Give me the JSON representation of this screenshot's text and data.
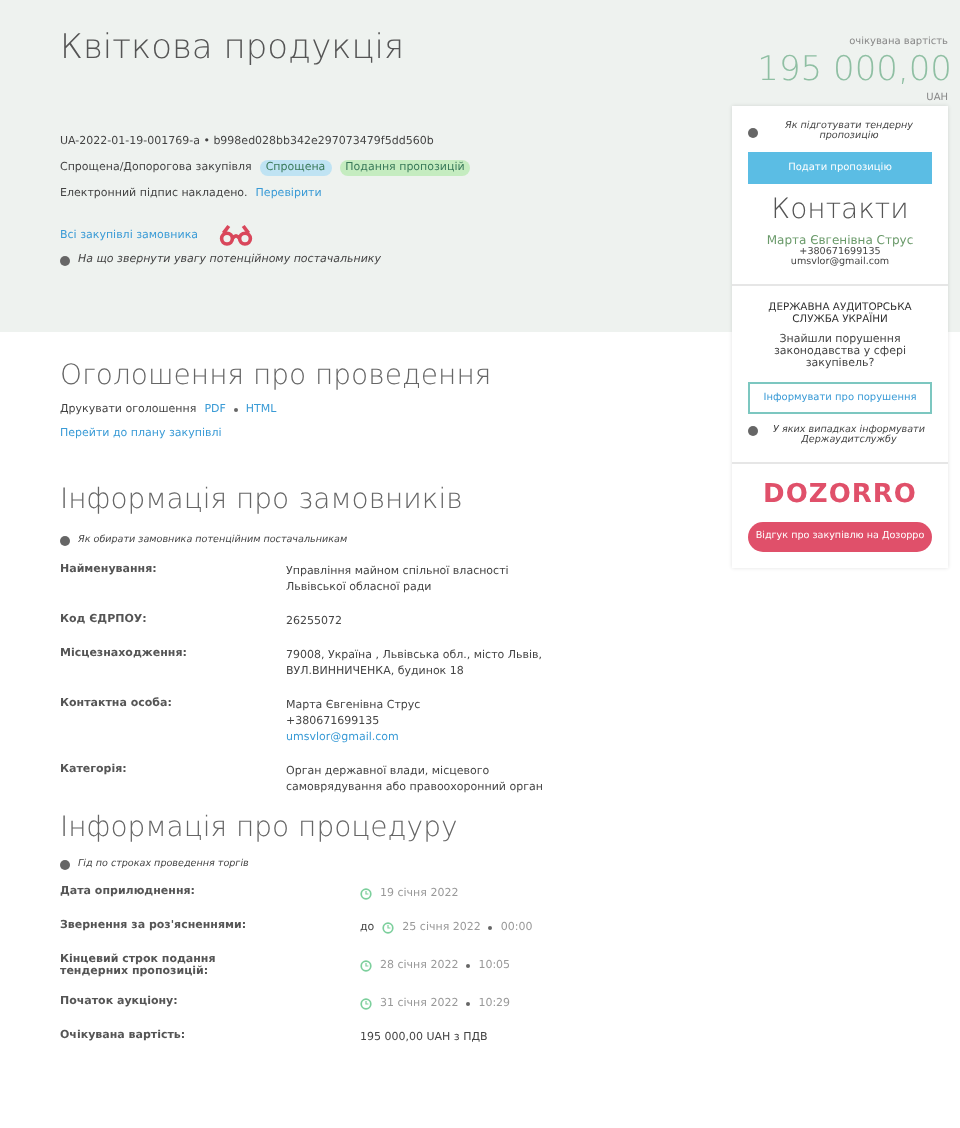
{
  "header": {
    "title": "Квіткова продукція",
    "tender_id": "UA-2022-01-19-001769-a • b998ed028bb342e297073479f5dd560b",
    "procedure_type": "Спрощена/Допорогова закупівля",
    "tags": [
      {
        "label": "Спрощена",
        "color": "#bfe3f3"
      },
      {
        "label": "Подання пропозицій",
        "color": "#c5ecc0"
      }
    ],
    "signature_text": "Електронний підпис накладено.",
    "signature_link": "Перевірити",
    "buyer_link": "Всі закупівлі замовника",
    "attention_hint": "На що звернути увагу потенційному постачальнику"
  },
  "price": {
    "caption": "очікувана вартість",
    "amount": "195 000,00",
    "currency": "UAH"
  },
  "sidebar": {
    "bid_hint": "Як підготувати тендерну пропозицію",
    "bid_button": "Подати пропозицію",
    "contacts_title": "Контакти",
    "contact_name": "Марта Євгенівна Струс",
    "contact_phone": "+380671699135",
    "contact_email": "umsvlor@gmail.com",
    "audit_title": "ДЕРЖАВНА АУДИТОРСЬКА СЛУЖБА УКРАЇНИ",
    "audit_question": "Знайшли порушення законодавства у сфері закупівель?",
    "audit_button": "Інформувати про порушення",
    "audit_hint": "У яких випадках інформувати Держаудитслужбу",
    "dozorro_logo": "DOZORRO",
    "dozorro_button": "Відгук про закупівлю на Дозорро"
  },
  "announcement": {
    "title": "Оголошення про проведення",
    "print_text": "Друкувати оголошення",
    "print_links": [
      "PDF",
      "HTML"
    ],
    "plan_link": "Перейти до плану закупівлі"
  },
  "buyer_info": {
    "title": "Інформація про замовників",
    "hint": "Як обирати замовника потенційним постачальникам",
    "rows": [
      {
        "label": "Найменування:",
        "lines": [
          "Управління майном спільної власності",
          "Львівської обласної ради"
        ]
      },
      {
        "label": "Код ЄДРПОУ:",
        "lines": [
          "26255072"
        ]
      },
      {
        "label": "Місцезнаходження:",
        "lines": [
          "79008, Україна , Львівська обл., місто Львів,",
          "ВУЛ.ВИННИЧЕНКА, будинок 18"
        ]
      },
      {
        "label": "Контактна особа:",
        "lines": [
          "Марта Євгенівна Струс",
          "+380671699135"
        ],
        "link": "umsvlor@gmail.com"
      },
      {
        "label": "Категорія:",
        "lines": [
          "Орган державної влади, місцевого",
          "самоврядування або правоохоронний орган"
        ]
      }
    ]
  },
  "procedure": {
    "title": "Інформація про процедуру",
    "hint": "Гід по строках проведення торгів",
    "rows": [
      {
        "label": "Дата оприлюднення:",
        "prefix": "",
        "date": "19 січня 2022",
        "time": ""
      },
      {
        "label": "Звернення за роз'ясненнями:",
        "prefix": "до",
        "date": "25 січня 2022",
        "time": "00:00"
      },
      {
        "label": "Кінцевий строк подання тендерних пропозицій:",
        "prefix": "",
        "date": "28 січня 2022",
        "time": "10:05"
      },
      {
        "label": "Початок аукціону:",
        "prefix": "",
        "date": "31 січня 2022",
        "time": "10:29"
      },
      {
        "label": "Очікувана вартість:",
        "value": "195 000,00 UAH з ПДВ"
      }
    ]
  }
}
